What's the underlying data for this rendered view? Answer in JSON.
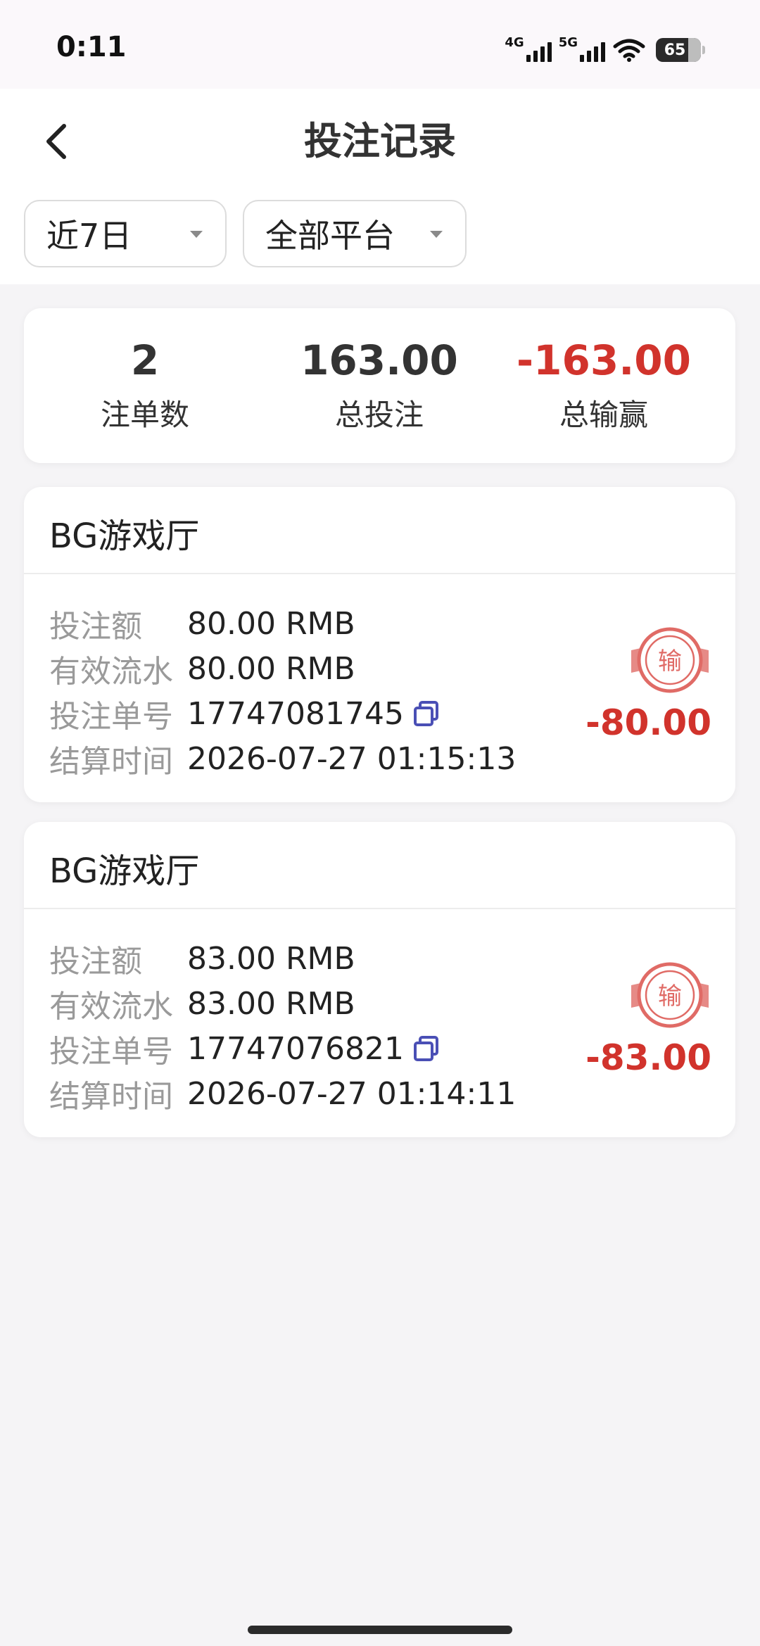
{
  "status_bar": {
    "time": "0:11",
    "net1": "4G",
    "net2": "5G",
    "battery": "65"
  },
  "header": {
    "title": "投注记录",
    "filters": [
      {
        "label": "近7日"
      },
      {
        "label": "全部平台"
      }
    ]
  },
  "summary": {
    "items": [
      {
        "value": "2",
        "label": "注单数"
      },
      {
        "value": "163.00",
        "label": "总投注"
      },
      {
        "value": "-163.00",
        "label": "总输赢"
      }
    ]
  },
  "bets": [
    {
      "venue": "BG游戏厅",
      "rows": [
        {
          "key": "投注额",
          "value": "80.00 RMB"
        },
        {
          "key": "有效流水",
          "value": "80.00 RMB"
        },
        {
          "key": "投注单号",
          "value": "17747081745"
        },
        {
          "key": "结算时间",
          "value": "2026-07-27 01:15:13"
        }
      ],
      "stamp": "输",
      "result": "-80.00"
    },
    {
      "venue": "BG游戏厅",
      "rows": [
        {
          "key": "投注额",
          "value": "83.00 RMB"
        },
        {
          "key": "有效流水",
          "value": "83.00 RMB"
        },
        {
          "key": "投注单号",
          "value": "17747076821"
        },
        {
          "key": "结算时间",
          "value": "2026-07-27 01:14:11"
        }
      ],
      "stamp": "输",
      "result": "-83.00"
    }
  ],
  "colors": {
    "negative": "#d1332c",
    "copy_icon": "#4a4fb5",
    "stamp": "#e06b66"
  },
  "icons": [
    "back-arrow-icon",
    "dropdown-caret-icon",
    "copy-icon",
    "lose-stamp-icon",
    "wifi-icon",
    "signal-icon",
    "battery-icon"
  ]
}
